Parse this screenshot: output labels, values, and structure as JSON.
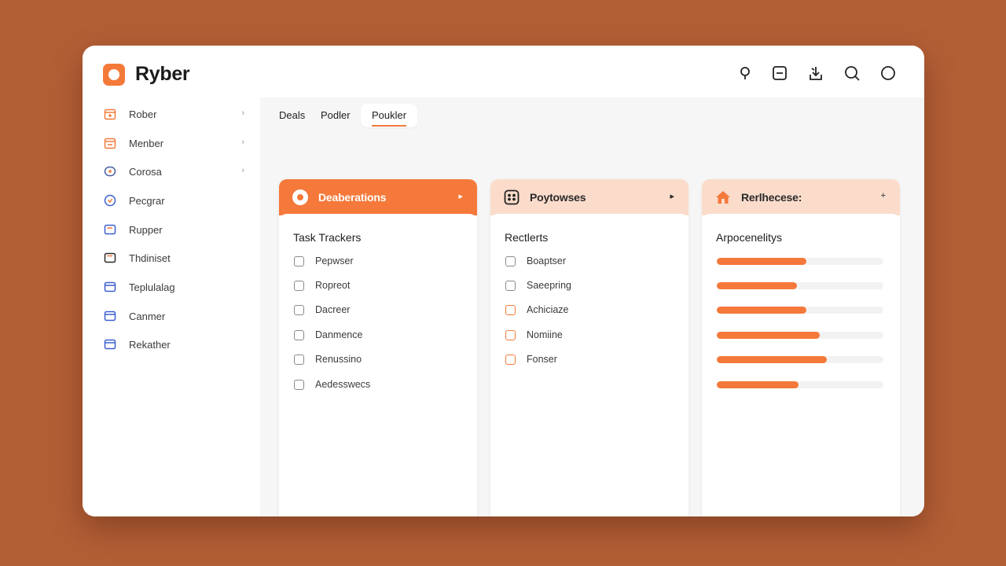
{
  "app": {
    "title": "Ryber"
  },
  "header_icons": [
    "location-pin-icon",
    "minus-square-icon",
    "pin-down-icon",
    "search-icon",
    "circle-icon"
  ],
  "sidebar": {
    "items": [
      {
        "label": "Rober",
        "icon": "calendar-icon",
        "chevron": true
      },
      {
        "label": "Menber",
        "icon": "calendar-icon",
        "chevron": true
      },
      {
        "label": "Corosa",
        "icon": "pill-icon",
        "chevron": true
      },
      {
        "label": "Pecgrar",
        "icon": "clock-icon",
        "chevron": false
      },
      {
        "label": "Rupper",
        "icon": "window-icon",
        "chevron": false
      },
      {
        "label": "Thdiniset",
        "icon": "panel-icon",
        "chevron": false
      },
      {
        "label": "Teplulalag",
        "icon": "window-icon",
        "chevron": false
      },
      {
        "label": "Canmer",
        "icon": "window-icon",
        "chevron": false
      },
      {
        "label": "Rekather",
        "icon": "window-icon",
        "chevron": false
      }
    ]
  },
  "tabs": [
    {
      "label": "Deals"
    },
    {
      "label": "Podler"
    },
    {
      "label": "Poukler",
      "active": true
    }
  ],
  "cards": [
    {
      "header": "Deaberations",
      "header_action": "▸",
      "title": "Task Trackers",
      "items": [
        "Pepwser",
        "Ropreot",
        "Dacreer",
        "Danmence",
        "Renussino",
        "Aedesswecs"
      ]
    },
    {
      "header": "Poytowses",
      "header_action": "▸",
      "title": "Rectlerts",
      "items": [
        "Boaptser",
        "Saeepring",
        "Achiciaze",
        "Nomiine",
        "Fonser"
      ]
    },
    {
      "header": "Rerlhecese:",
      "header_action": "+",
      "title": "Arpocenelitys",
      "progress": [
        0.54,
        0.48,
        0.54,
        0.62,
        0.66,
        0.49
      ]
    }
  ],
  "colors": {
    "accent": "#f5793a",
    "accent_soft": "#fbdccb",
    "background": "#b35f36",
    "blue_icon": "#3c5fd0"
  }
}
